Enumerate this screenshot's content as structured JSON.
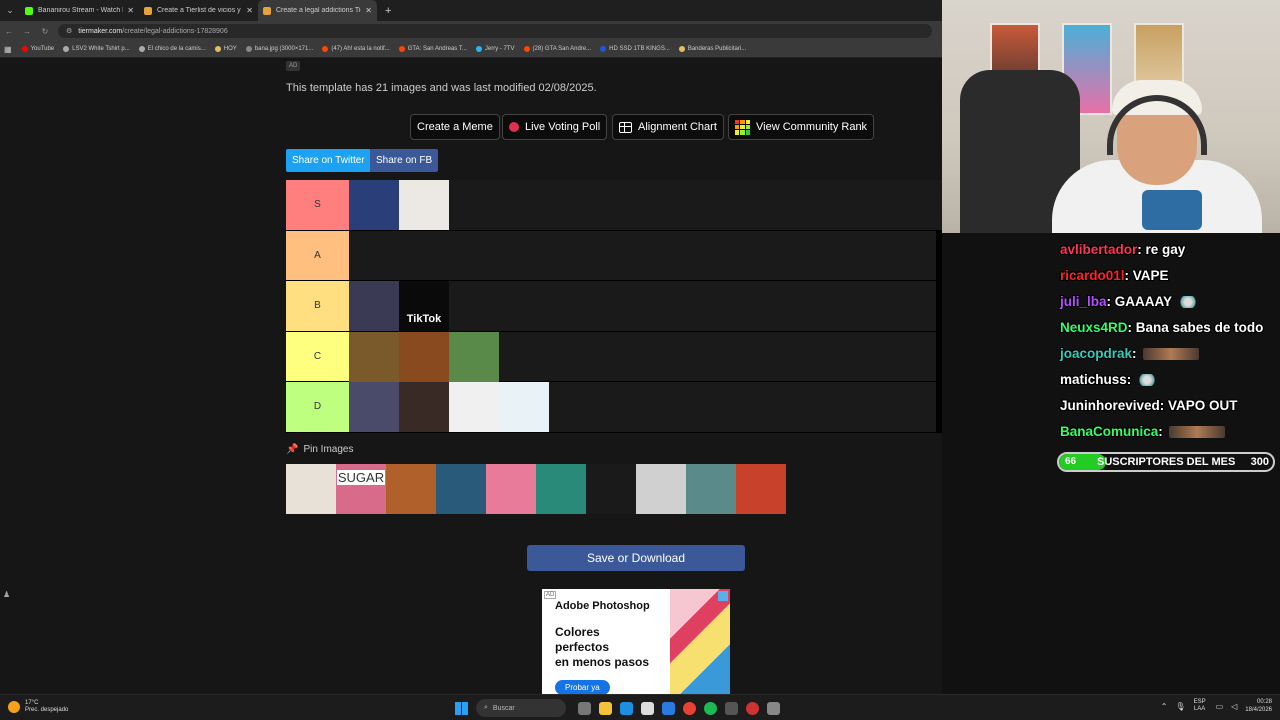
{
  "browser": {
    "tabs": [
      {
        "title": "Bananirou Stream - Watch Live",
        "icon_color": "#53fc18",
        "active": false
      },
      {
        "title": "Create a Tierlist de vicios y adic",
        "icon_color": "#e6a23c",
        "active": false
      },
      {
        "title": "Create a legal addictions Tier L",
        "icon_color": "#e6a23c",
        "active": true
      }
    ],
    "url_domain": "tiermaker.com",
    "url_path": "/create/legal-addictions-17828906",
    "bookmarks": [
      {
        "label": "YouTube",
        "color": "#ff0000"
      },
      {
        "label": "LSV2 White Tshirt p...",
        "color": "#aaaaaa"
      },
      {
        "label": "El chico de la camis...",
        "color": "#aaaaaa"
      },
      {
        "label": "HOY",
        "color": "#e0c060"
      },
      {
        "label": "bana.jpg (3000×171...",
        "color": "#888888"
      },
      {
        "label": "(47) Ah! esta la notif...",
        "color": "#ff4500"
      },
      {
        "label": "GTA: San Andreas T...",
        "color": "#ff4500"
      },
      {
        "label": "Jerry - 7TV",
        "color": "#29b6f6"
      },
      {
        "label": "(28) GTA San Andre...",
        "color": "#ff4500"
      },
      {
        "label": "HD SSD 1TB KINGS...",
        "color": "#2255dd"
      },
      {
        "label": "Banderas Publicitari...",
        "color": "#e0c060"
      }
    ]
  },
  "page": {
    "ad_tag": "AD",
    "template_info": "This template has 21 images and was last modified 02/08/2025.",
    "actions": [
      {
        "label": "Create a Meme",
        "icon": "none"
      },
      {
        "label": "Live Voting Poll",
        "icon": "red-dot-icon"
      },
      {
        "label": "Alignment Chart",
        "icon": "grid-icon"
      },
      {
        "label": "View Community Rank",
        "icon": "rank-grid-icon"
      }
    ],
    "share": [
      {
        "label": "Share on Twitter",
        "color": "#1da1f2"
      },
      {
        "label": "Share on FB",
        "color": "#3b5998"
      }
    ],
    "tiers": [
      {
        "label": "S",
        "color": "#ff7f7f",
        "items": [
          "#2a3f7a",
          "#ece9e4"
        ],
        "item_names": [
          "energy-drinks-image",
          "coffee-image"
        ]
      },
      {
        "label": "A",
        "color": "#ffbf7f",
        "items": [],
        "item_names": []
      },
      {
        "label": "B",
        "color": "#ffdf7f",
        "items": [
          "#3a3a55",
          "#0a0a0a"
        ],
        "item_names": [
          "smartphone-image",
          "tiktok-image"
        ]
      },
      {
        "label": "C",
        "color": "#ffff7f",
        "items": [
          "#7a5a2a",
          "#8a4a20",
          "#5a8a4a"
        ],
        "item_names": [
          "alcohol-image",
          "junk-food-image",
          "trading-image"
        ]
      },
      {
        "label": "D",
        "color": "#bfff7f",
        "items": [
          "#4a4a6a",
          "#3a2a25",
          "#f0f0f0",
          "#e9f2f7"
        ],
        "item_names": [
          "sports-betting-image",
          "sugar-spoon-image",
          "cigarette-image",
          "vape-image"
        ]
      }
    ],
    "tiktok_text": "TikTok",
    "pin_label": "Pin Images",
    "pin_images": [
      "#e8e1d8",
      "#d86a8a",
      "#b0602a",
      "#2a5a7a",
      "#e87a9a",
      "#2a8a7a",
      "#1a1a1a",
      "#d0d0d0",
      "#5a8a8a",
      "#c8412a"
    ],
    "pin_image_names": [
      "sugar-cubes-image",
      "sugar-donuts-image",
      "fast-food-image",
      "slot-machines-image",
      "lips-image",
      "cannabis-image",
      "cocaine-image",
      "adult-content-image",
      "vaping-person-image",
      "zyn-pouches-image"
    ],
    "pin_text": "SUGAR",
    "save_label": "Save or Download",
    "ad": {
      "label": "AD",
      "brand": "Adobe Photoshop",
      "headline": "Colores\nperfectos\nen menos pasos",
      "cta": "Probar ya"
    }
  },
  "chat": [
    {
      "user": "avlibertador",
      "color": "#ff3355",
      "text": ": re gay",
      "emote": false
    },
    {
      "user": "ricardo01l",
      "color": "#ff2222",
      "text": ": VAPE",
      "emote": false
    },
    {
      "user": "juli_lba",
      "color": "#b44dff",
      "text": ": GAAAAY",
      "emote": "small"
    },
    {
      "user": "Neuxs4RD",
      "color": "#33ff66",
      "text": ": Bana sabes de todo",
      "emote": false
    },
    {
      "user": "joacopdrak",
      "color": "#33ccbb",
      "text": ":",
      "emote": "large"
    },
    {
      "user": "matichuss",
      "color": "#ffffff",
      "text": ":",
      "emote": "small"
    },
    {
      "user": "Juninhorevived",
      "color": "#ffffff",
      "text": ": VAPO OUT",
      "emote": false
    },
    {
      "user": "BanaComunica",
      "color": "#33ff66",
      "text": ":",
      "emote": "large"
    }
  ],
  "subgoal": {
    "current": "66",
    "label": "SUSCRIPTORES DEL MES",
    "goal": "300",
    "progress": 0.22
  },
  "taskbar": {
    "weather_temp": "17°C",
    "weather_desc": "Prec. despejado",
    "search_placeholder": "Buscar",
    "lang_top": "ESP",
    "lang_bottom": "LAA",
    "time": "00:28",
    "date": "18/4/2026"
  }
}
